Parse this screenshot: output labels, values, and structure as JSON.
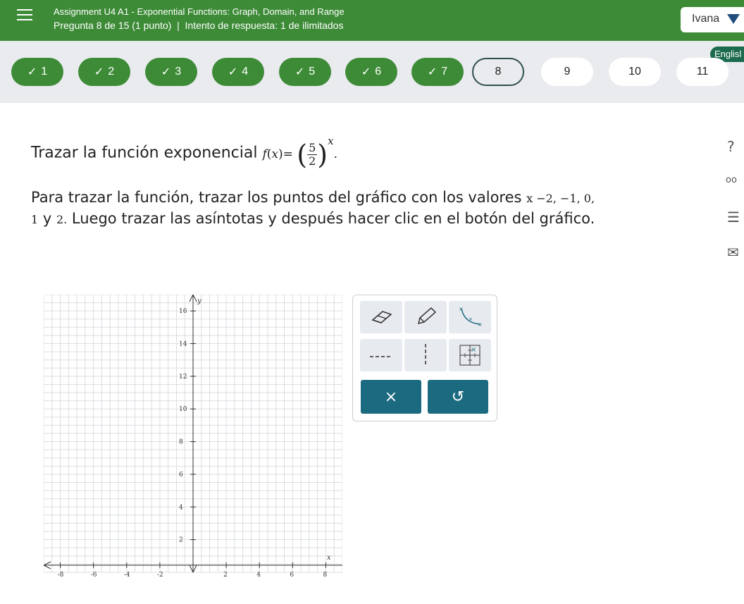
{
  "header": {
    "assignment_title": "Assignment U4 A1 - Exponential Functions: Graph, Domain, and Range",
    "question_info": "Pregunta 8 de 15 (1 punto)",
    "attempt_info": "Intento de respuesta: 1 de ilimitados",
    "user_name": "Ivana"
  },
  "language_button": "Englisl",
  "questions": [
    {
      "label": "1",
      "status": "done"
    },
    {
      "label": "2",
      "status": "done"
    },
    {
      "label": "3",
      "status": "done"
    },
    {
      "label": "4",
      "status": "done"
    },
    {
      "label": "5",
      "status": "done"
    },
    {
      "label": "6",
      "status": "done"
    },
    {
      "label": "7",
      "status": "done"
    },
    {
      "label": "8",
      "status": "current"
    },
    {
      "label": "9",
      "status": "todo"
    },
    {
      "label": "10",
      "status": "todo"
    },
    {
      "label": "11",
      "status": "todo"
    }
  ],
  "check_glyph": "✓",
  "problem": {
    "intro": "Trazar la función exponencial",
    "func_lhs": "f",
    "func_arg": "x",
    "frac_num": "5",
    "frac_den": "2",
    "exponent": "x",
    "end_dot": ".",
    "line2_text": "Para trazar la función, trazar los puntos del gráfico con los valores",
    "line2_values": "x −2, −1, 0,",
    "line3_values_start": "1",
    "line3_y": " y ",
    "line3_values_2": "2.",
    "line3_text": " Luego trazar las asíntotas y después hacer clic en el botón del gráfico."
  },
  "side_icons": {
    "help": "?",
    "glasses": "oo",
    "notes": "☰",
    "mail": "✉"
  },
  "graph": {
    "x_axis_label": "x",
    "y_axis_label": "y",
    "x_ticks": [
      -8,
      -6,
      -4,
      -2,
      2,
      4,
      6,
      8
    ],
    "y_ticks": [
      2,
      4,
      6,
      8,
      10,
      12,
      14,
      16
    ],
    "x_range": [
      -9,
      9
    ],
    "y_range": [
      0,
      17
    ]
  },
  "tools": {
    "clear_label": "×",
    "undo_label": "↺"
  }
}
